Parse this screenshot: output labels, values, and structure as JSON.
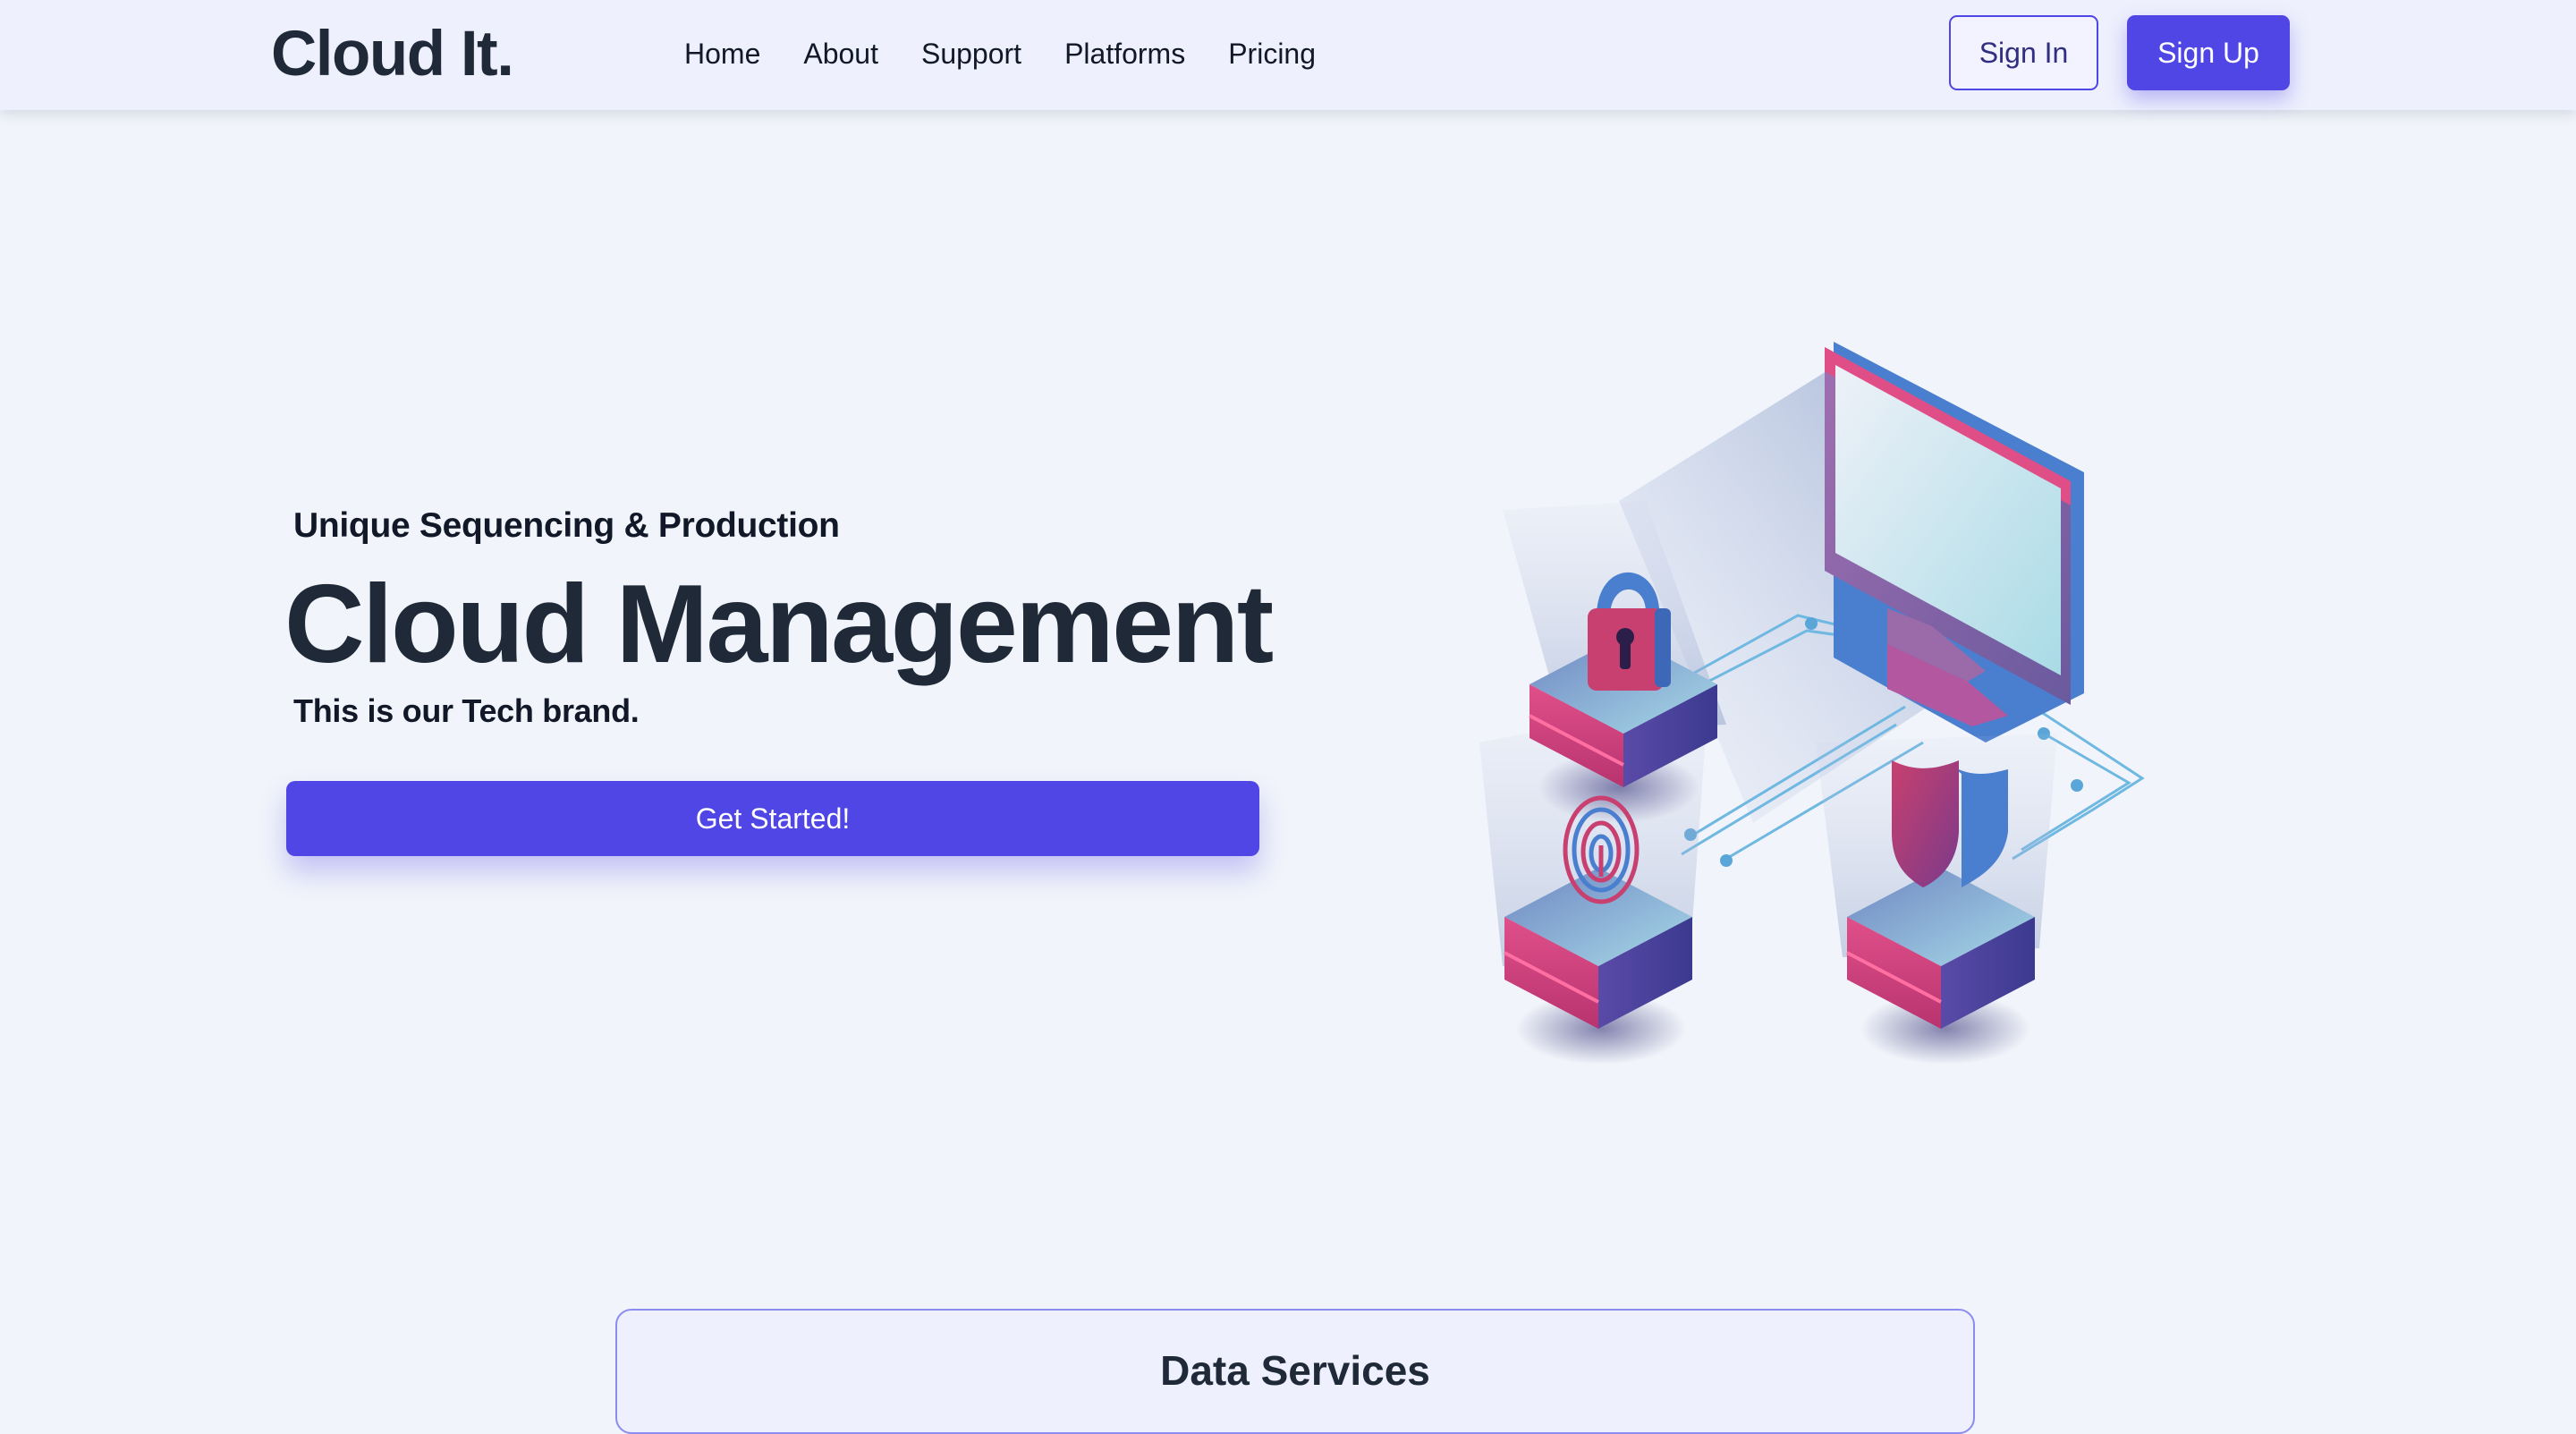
{
  "brand": {
    "name": "Cloud It."
  },
  "nav": {
    "links": [
      "Home",
      "About",
      "Support",
      "Platforms",
      "Pricing"
    ]
  },
  "auth": {
    "sign_in": "Sign In",
    "sign_up": "Sign Up"
  },
  "hero": {
    "eyebrow": "Unique Sequencing & Production",
    "title": "Cloud Management",
    "subtitle": "This is our Tech brand.",
    "cta": "Get Started!",
    "illustration_icons": [
      "monitor-icon",
      "padlock-icon",
      "fingerprint-icon",
      "shield-icon"
    ]
  },
  "services": {
    "title": "Data Services"
  },
  "colors": {
    "accent": "#4f46e5",
    "background": "#f1f4fa",
    "navbar": "#eef0fd",
    "text": "#1f2937",
    "magenta": "#d8457f",
    "blue": "#4a7fd0"
  }
}
